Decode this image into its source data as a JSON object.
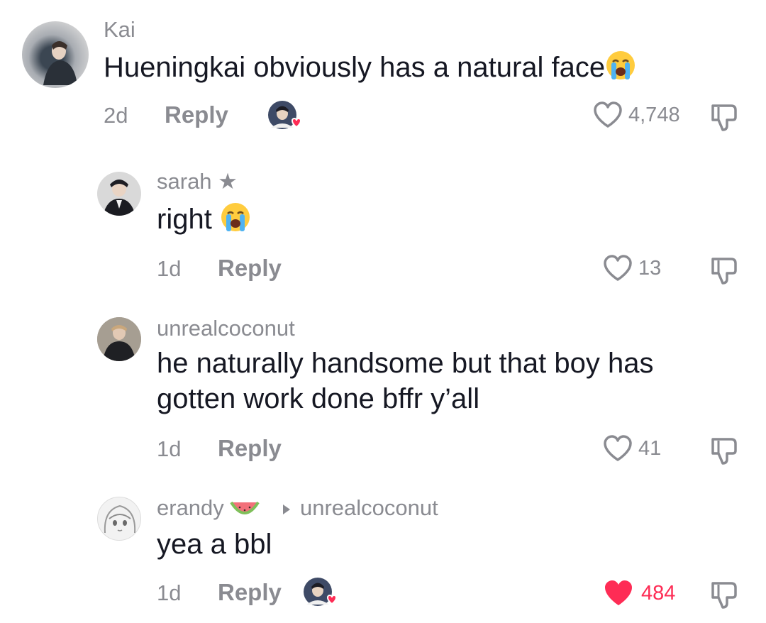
{
  "comments": [
    {
      "username": "Kai",
      "text": "Hueningkai obviously has a natural face",
      "emoji": "crying-face",
      "time": "2d",
      "reply_label": "Reply",
      "liked_by_creator": true,
      "likes": "4,748",
      "liked": false
    },
    {
      "username": "sarah",
      "badge": "★",
      "text": "right",
      "emoji": "crying-face",
      "time": "1d",
      "reply_label": "Reply",
      "liked_by_creator": false,
      "likes": "13",
      "liked": false
    },
    {
      "username": "unrealcoconut",
      "text_line1": "he naturally handsome but that boy has",
      "text_line2": "gotten work done bffr y’all",
      "time": "1d",
      "reply_label": "Reply",
      "liked_by_creator": false,
      "likes": "41",
      "liked": false
    },
    {
      "username": "erandy",
      "username_emoji": "watermelon",
      "reply_to": "unrealcoconut",
      "text": "yea a bbl",
      "time": "1d",
      "reply_label": "Reply",
      "liked_by_creator": true,
      "likes": "484",
      "liked": true
    }
  ],
  "colors": {
    "text": "#161823",
    "secondary": "#8a8b91",
    "like_red": "#fe2c55"
  }
}
